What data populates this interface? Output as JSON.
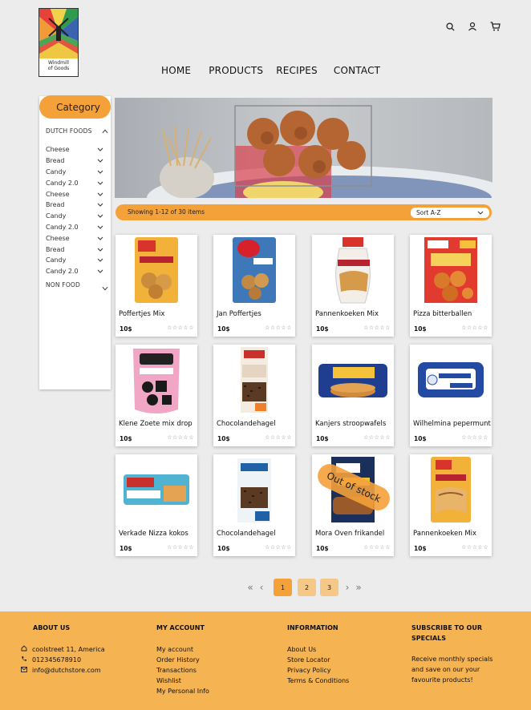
{
  "brand": {
    "line1": "Windmill",
    "line2": "of Goods"
  },
  "nav": [
    "HOME",
    "PRODUCTS",
    "RECIPES",
    "CONTACT"
  ],
  "sidebar": {
    "title": "Category",
    "section1": "DUTCH FOODS",
    "items": [
      "Cheese",
      "Bread",
      "Candy",
      "Candy 2.0",
      "Cheese",
      "Bread",
      "Candy",
      "Candy 2.0",
      "Cheese",
      "Bread",
      "Candy",
      "Candy 2.0"
    ],
    "section2": "NON FOOD"
  },
  "toolbar": {
    "showing": "Showing 1-12 of 30 items",
    "sort": "Sort A-Z"
  },
  "products": [
    {
      "name": "Poffertjes Mix",
      "price": "10$"
    },
    {
      "name": "Jan Poffertjes",
      "price": "10$"
    },
    {
      "name": "Pannenkoeken Mix",
      "price": "10$"
    },
    {
      "name": "Pizza bitterballen",
      "price": "10$"
    },
    {
      "name": "Klene Zoete mix drop",
      "price": "10$"
    },
    {
      "name": "Chocolandehagel",
      "price": "10$"
    },
    {
      "name": "Kanjers stroopwafels",
      "price": "10$"
    },
    {
      "name": "Wilhelmina pepermunt",
      "price": "10$"
    },
    {
      "name": "Verkade Nizza kokos",
      "price": "10$"
    },
    {
      "name": "Chocolandehagel",
      "price": "10$"
    },
    {
      "name": "Mora Oven frikandel",
      "price": "10$",
      "out_of_stock": "Out of stock"
    },
    {
      "name": "Pannenkoeken Mix",
      "price": "10$"
    }
  ],
  "pagination": {
    "pages": [
      "1",
      "2",
      "3"
    ],
    "active": "1"
  },
  "footer": {
    "about": {
      "title": "ABOUT US",
      "address": "coolstreet 11, America",
      "phone": "012345678910",
      "email": "info@dutchstore.com"
    },
    "account": {
      "title": "MY ACCOUNT",
      "links": [
        "My account",
        "Order History",
        "Transactions",
        "Wishlist",
        "My Personal Info"
      ]
    },
    "info": {
      "title": "INFORMATION",
      "links": [
        "About Us",
        "Store Locator",
        "Privacy Policy",
        "Terms & Conditions"
      ]
    },
    "subscribe": {
      "title": "SUBSCRIBE TO OUR SPECIALS",
      "text": "Receive monthly specials and save on our your favourite products!"
    }
  },
  "colors": {
    "accent": "#f5a13a",
    "footer": "#f6b351",
    "background": "#ececec"
  }
}
